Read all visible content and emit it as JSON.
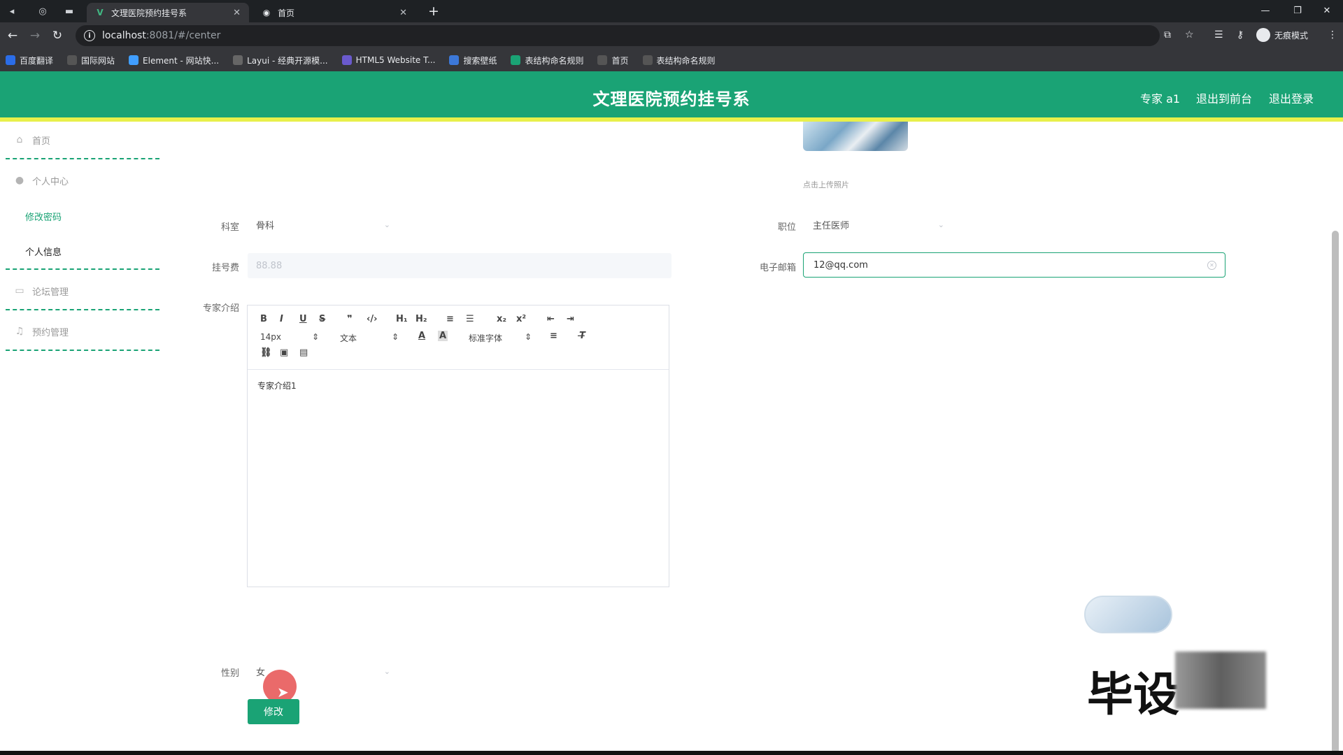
{
  "browser": {
    "tabs": [
      {
        "title": "文理医院预约挂号系",
        "active": true
      },
      {
        "title": "首页",
        "active": false
      }
    ],
    "url_host": "localhost",
    "url_path": ":8081/#/center",
    "profile_label": "无痕模式",
    "bookmarks": [
      {
        "label": "百度翻译",
        "icon": "translate-icon",
        "color": "#2b6de8"
      },
      {
        "label": "国际网站",
        "icon": "flag-icon",
        "color": "#555555"
      },
      {
        "label": "Element - 网站快...",
        "icon": "element-icon",
        "color": "#409eff"
      },
      {
        "label": "Layui - 经典开源模...",
        "icon": "layui-icon",
        "color": "#666666"
      },
      {
        "label": "HTML5 Website T...",
        "icon": "html5-icon",
        "color": "#6a5acd"
      },
      {
        "label": "搜索壁纸",
        "icon": "wallpaper-icon",
        "color": "#3c78d8"
      },
      {
        "label": "表结构命名规则",
        "icon": "table-icon",
        "color": "#1aa375"
      },
      {
        "label": "首页",
        "icon": "globe-icon",
        "color": "#555555"
      },
      {
        "label": "表结构命名规则",
        "icon": "globe-icon",
        "color": "#555555"
      }
    ]
  },
  "header": {
    "title": "文理医院预约挂号系",
    "links": [
      "专家 a1",
      "退出到前台",
      "退出登录"
    ],
    "colors": {
      "bg": "#1aa375",
      "accent_strip": "#e8f04a"
    }
  },
  "sidebar": {
    "items": [
      {
        "label": "首页",
        "icon": "home-icon"
      },
      {
        "label": "个人中心",
        "icon": "user-icon"
      },
      {
        "label": "论坛管理",
        "icon": "chat-icon"
      },
      {
        "label": "预约管理",
        "icon": "bell-icon"
      }
    ],
    "subitems": [
      {
        "label": "修改密码",
        "active": true
      },
      {
        "label": "个人信息",
        "active": false
      }
    ]
  },
  "form": {
    "upload_hint": "点击上传照片",
    "department_label": "科室",
    "department_value": "骨科",
    "position_label": "职位",
    "position_value": "主任医师",
    "fee_label": "挂号费",
    "fee_value": "88.88",
    "email_label": "电子邮箱",
    "email_value": "12@qq.com",
    "intro_label": "专家介绍",
    "intro_value": "专家介绍1",
    "gender_label": "性别",
    "gender_value": "女",
    "save_label": "修改"
  },
  "editor": {
    "font_size": "14px",
    "block_format": "文本",
    "font_family": "标准字体"
  },
  "watermark": {
    "text": "毕设"
  }
}
